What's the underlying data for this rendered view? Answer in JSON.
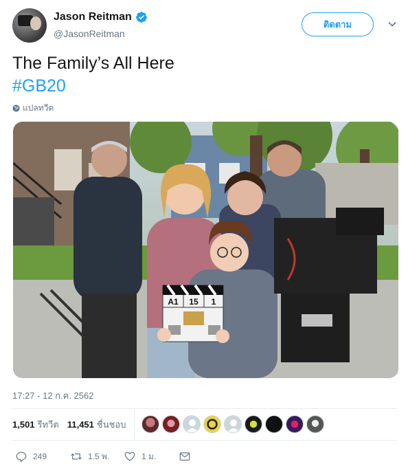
{
  "author": {
    "display_name": "Jason Reitman",
    "handle": "@JasonReitman",
    "verified": true
  },
  "follow_label": "ติดตาม",
  "tweet": {
    "text": "The Family’s All Here",
    "hashtag": "#GB20",
    "translate_label": "แปลทวีต",
    "timestamp": "17:27 - 12 ก.ค. 2562"
  },
  "photo": {
    "clapper": {
      "scene": "A1",
      "take_shot": "15",
      "take": "1"
    }
  },
  "stats": {
    "retweets_count": "1,501",
    "retweets_label": "รีทวีต",
    "likes_count": "11,451",
    "likes_label": "ชื่นชอบ"
  },
  "actions": {
    "reply_count": "249",
    "retweet_count": "1.5 พ.",
    "like_count": "1 ม."
  },
  "colors": {
    "accent": "#1da1f2",
    "text": "#14171a",
    "muted": "#657786",
    "border": "#e6ecf0"
  },
  "icons": {
    "verified": "verified-badge-icon",
    "caret": "chevron-down-icon",
    "globe": "globe-icon",
    "reply": "reply-icon",
    "retweet": "retweet-icon",
    "like": "heart-icon",
    "dm": "envelope-icon"
  }
}
